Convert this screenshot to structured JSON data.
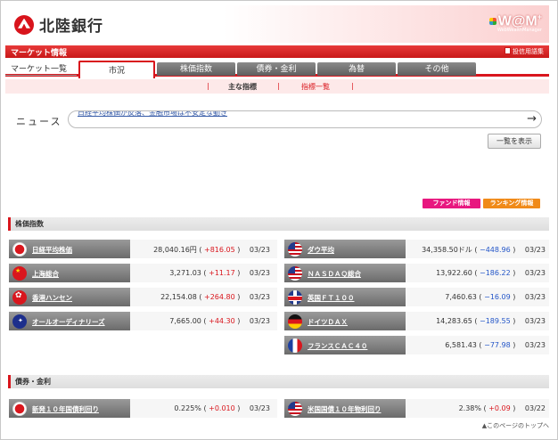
{
  "header": {
    "bank_name": "北陸銀行",
    "wm_logo": "W@M",
    "wm_plus": "+",
    "wm_sub": "WebWealthManager",
    "logo_icon": "hokuriku-bank-logo-icon"
  },
  "redbar": {
    "title": "マーケット情報",
    "glossary_label": "投信用語集",
    "glossary_icon": "book-icon"
  },
  "tabs": [
    {
      "label": "マーケット一覧"
    },
    {
      "label": "市況"
    },
    {
      "label": "株価指数"
    },
    {
      "label": "債券・金利"
    },
    {
      "label": "為替"
    },
    {
      "label": "その他"
    }
  ],
  "subnav": {
    "main_label": "主な指標",
    "index_label": "指標一覧",
    "sep": "|"
  },
  "news": {
    "label": "ニュース",
    "scroll_text": "日経平均株価が反落、金融市場は不安定な動き",
    "arrow": "→",
    "list_button": "一覧を表示"
  },
  "buttons": {
    "fund_info": "ファンド情報",
    "ranking_info": "ランキング情報"
  },
  "sections": {
    "stock_index": "株価指数",
    "bond_rate": "債券・金利"
  },
  "stock_left": [
    {
      "flag": "japan-flag-icon",
      "name": "日経平均株価",
      "value": "28,040.16円",
      "change": "+816.05",
      "date": "03/23",
      "dir": "up"
    },
    {
      "flag": "china-flag-icon",
      "name": "上海総合",
      "value": "3,271.03",
      "change": "+11.17",
      "date": "03/23",
      "dir": "up"
    },
    {
      "flag": "hongkong-flag-icon",
      "name": "香港ハンセン",
      "value": "22,154.08",
      "change": "+264.80",
      "date": "03/23",
      "dir": "up"
    },
    {
      "flag": "australia-flag-icon",
      "name": "オールオーディナリーズ",
      "value": "7,665.00",
      "change": "+44.30",
      "date": "03/23",
      "dir": "up"
    }
  ],
  "stock_right": [
    {
      "flag": "usa-flag-icon",
      "name": "ダウ平均",
      "value": "34,358.50ドル",
      "change": "−448.96",
      "date": "03/23",
      "dir": "down"
    },
    {
      "flag": "usa-flag-icon",
      "name": "ＮＡＳＤＡＱ総合",
      "value": "13,922.60",
      "change": "−186.22",
      "date": "03/23",
      "dir": "down"
    },
    {
      "flag": "uk-flag-icon",
      "name": "英国ＦＴ１００",
      "value": "7,460.63",
      "change": "−16.09",
      "date": "03/23",
      "dir": "down"
    },
    {
      "flag": "germany-flag-icon",
      "name": "ドイツＤＡＸ",
      "value": "14,283.65",
      "change": "−189.55",
      "date": "03/23",
      "dir": "down"
    },
    {
      "flag": "france-flag-icon",
      "name": "フランスＣＡＣ４０",
      "value": "6,581.43",
      "change": "−77.98",
      "date": "03/23",
      "dir": "down"
    }
  ],
  "bond_left": [
    {
      "flag": "japan-flag-icon",
      "name": "新発１０年国債利回り",
      "value": "0.225%",
      "change": "+0.010",
      "date": "03/23",
      "dir": "up"
    }
  ],
  "bond_right": [
    {
      "flag": "usa-flag-icon",
      "name": "米国国債１０年物利回り",
      "value": "2.38%",
      "change": "+0.09",
      "date": "03/22",
      "dir": "up"
    }
  ],
  "page_top": "▲このページのトップへ",
  "colors": {
    "brand_red": "#d9161d",
    "up": "#d9161d",
    "down": "#2456c8",
    "fund_pink": "#e8177f",
    "ranking_orange": "#f08a18"
  }
}
